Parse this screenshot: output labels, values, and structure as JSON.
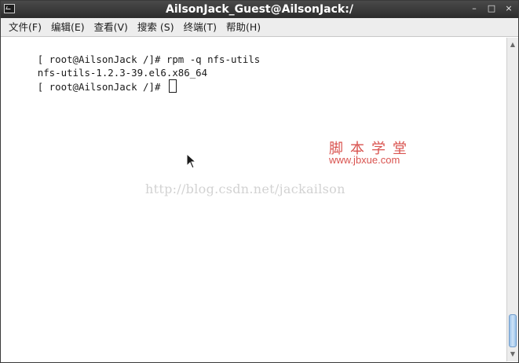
{
  "window": {
    "title": "AilsonJack_Guest@AilsonJack:/",
    "controls": {
      "minimize": "–",
      "maximize": "□",
      "close": "×"
    }
  },
  "menu": {
    "items": [
      {
        "label": "文件(F)"
      },
      {
        "label": "编辑(E)"
      },
      {
        "label": "查看(V)"
      },
      {
        "label": "搜索 (S)"
      },
      {
        "label": "终端(T)"
      },
      {
        "label": "帮助(H)"
      }
    ]
  },
  "terminal": {
    "lines": [
      "[ root@AilsonJack /]# rpm -q nfs-utils",
      "nfs-utils-1.2.3-39.el6.x86_64",
      "[ root@AilsonJack /]# "
    ]
  },
  "watermarks": {
    "blog_url": "http://blog.csdn.net/jackailson",
    "site_cn": "脚本学堂",
    "site_url": "www.jbxue.com"
  }
}
